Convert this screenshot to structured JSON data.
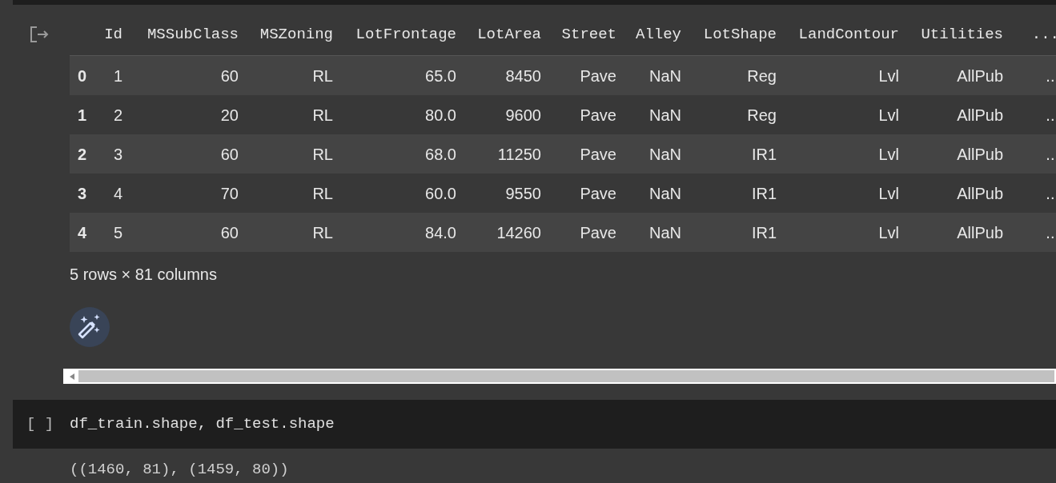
{
  "output_table": {
    "columns": [
      "Id",
      "MSSubClass",
      "MSZoning",
      "LotFrontage",
      "LotArea",
      "Street",
      "Alley",
      "LotShape",
      "LandContour",
      "Utilities",
      "..."
    ],
    "rows": [
      {
        "index": "0",
        "cells": [
          "1",
          "60",
          "RL",
          "65.0",
          "8450",
          "Pave",
          "NaN",
          "Reg",
          "Lvl",
          "AllPub",
          "..."
        ]
      },
      {
        "index": "1",
        "cells": [
          "2",
          "20",
          "RL",
          "80.0",
          "9600",
          "Pave",
          "NaN",
          "Reg",
          "Lvl",
          "AllPub",
          "..."
        ]
      },
      {
        "index": "2",
        "cells": [
          "3",
          "60",
          "RL",
          "68.0",
          "11250",
          "Pave",
          "NaN",
          "IR1",
          "Lvl",
          "AllPub",
          "..."
        ]
      },
      {
        "index": "3",
        "cells": [
          "4",
          "70",
          "RL",
          "60.0",
          "9550",
          "Pave",
          "NaN",
          "IR1",
          "Lvl",
          "AllPub",
          "..."
        ]
      },
      {
        "index": "4",
        "cells": [
          "5",
          "60",
          "RL",
          "84.0",
          "14260",
          "Pave",
          "NaN",
          "IR1",
          "Lvl",
          "AllPub",
          "..."
        ]
      }
    ],
    "summary": "5 rows × 81 columns"
  },
  "code_cell": {
    "run_marker": "[ ]",
    "code": "df_train.shape, df_test.shape",
    "output": "((1460, 81), (1459, 80))"
  }
}
